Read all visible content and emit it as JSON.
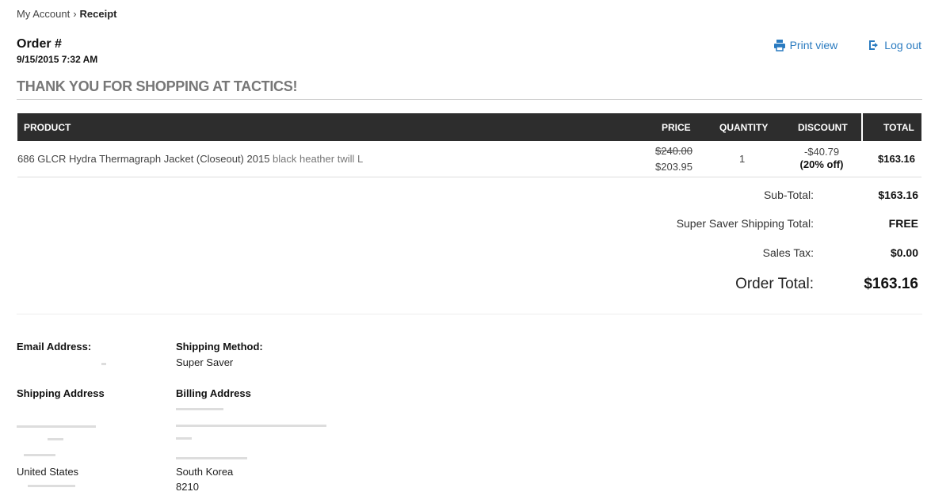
{
  "breadcrumb": {
    "parent": "My Account",
    "separator": "›",
    "current": "Receipt"
  },
  "order": {
    "title": "Order #",
    "date": "9/15/2015 7:32 AM"
  },
  "links": {
    "print": "Print view",
    "logout": "Log out"
  },
  "thanks": "THANK YOU FOR SHOPPING AT TACTICS!",
  "table": {
    "headers": {
      "product": "PRODUCT",
      "price": "PRICE",
      "quantity": "QUANTITY",
      "discount": "DISCOUNT",
      "total": "TOTAL"
    },
    "item": {
      "name": "686 GLCR Hydra Thermagraph Jacket (Closeout) 2015",
      "variant": "black heather twill L",
      "original_price": "$240.00",
      "price": "$203.95",
      "quantity": "1",
      "discount": "-$40.79",
      "discount_pct": "(20% off)",
      "total": "$163.16"
    }
  },
  "summary": {
    "subtotal_label": "Sub-Total:",
    "subtotal": "$163.16",
    "shipping_label": "Super Saver Shipping Total:",
    "shipping": "FREE",
    "tax_label": "Sales Tax:",
    "tax": "$0.00",
    "order_total_label": "Order Total:",
    "order_total": "$163.16"
  },
  "details": {
    "email_label": "Email Address:",
    "shipping_method_label": "Shipping Method:",
    "shipping_method": "Super Saver",
    "shipping_address_label": "Shipping Address",
    "shipping_country": "United States",
    "billing_address_label": "Billing Address",
    "billing_country": "South Korea",
    "billing_postal": "8210"
  },
  "colors": {
    "link": "#2a7bc0",
    "header_bg": "#2d2d2d",
    "heading_gray": "#777777"
  }
}
